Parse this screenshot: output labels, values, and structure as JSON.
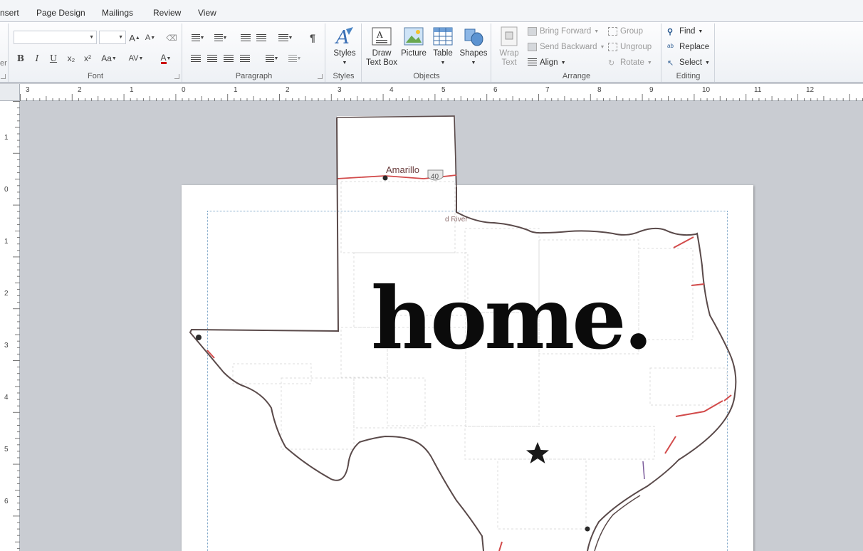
{
  "tabs": [
    "nsert",
    "Page Design",
    "Mailings",
    "Review",
    "View"
  ],
  "ribbon": {
    "clipboard_partial": "er",
    "font": {
      "label": "Font",
      "font_name": "",
      "font_size": "",
      "grow": "A",
      "shrink": "A",
      "bold": "B",
      "italic": "I",
      "underline": "U",
      "subscript": "x₂",
      "superscript": "x²",
      "change_case": "Aa",
      "spacing": "AV",
      "font_color": "A"
    },
    "paragraph": {
      "label": "Paragraph",
      "pilcrow": "¶"
    },
    "styles": {
      "label": "Styles",
      "button": "Styles"
    },
    "objects": {
      "label": "Objects",
      "draw_text_box_1": "Draw",
      "draw_text_box_2": "Text Box",
      "picture": "Picture",
      "table": "Table",
      "shapes": "Shapes"
    },
    "arrange": {
      "label": "Arrange",
      "wrap_text_1": "Wrap",
      "wrap_text_2": "Text",
      "bring_forward": "Bring Forward",
      "send_backward": "Send Backward",
      "align": "Align",
      "group": "Group",
      "ungroup": "Ungroup",
      "rotate": "Rotate"
    },
    "editing": {
      "label": "Editing",
      "find": "Find",
      "replace": "Replace",
      "select": "Select"
    }
  },
  "hruler_numbers": [
    "3",
    "2",
    "1",
    "0",
    "1",
    "2",
    "3",
    "4",
    "5",
    "6",
    "7",
    "8",
    "9",
    "10",
    "11",
    "12"
  ],
  "vruler_numbers": [
    "1",
    "0",
    "1",
    "2",
    "3",
    "4",
    "5",
    "6"
  ],
  "document": {
    "headline": "home.",
    "map_labels": {
      "city": "Amarillo",
      "highway": "40",
      "river": "d River"
    },
    "colors": {
      "road": "#d24b4b",
      "border": "#5a4a4a",
      "guide": "#7ea6c8"
    }
  }
}
